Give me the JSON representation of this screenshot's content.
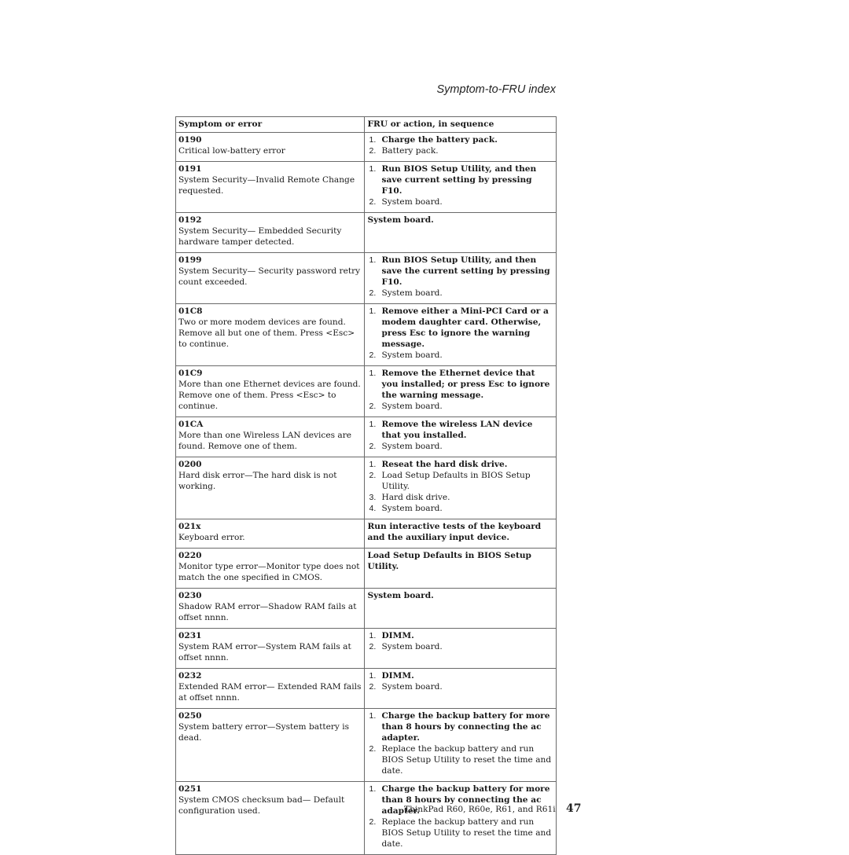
{
  "running_head": "Symptom-to-FRU index",
  "table": {
    "headers": [
      "Symptom or error",
      "FRU or action, in sequence"
    ],
    "rows": [
      {
        "code": "0190",
        "symptom": "Critical low-battery error",
        "actions": [
          {
            "n": "1.",
            "text": "Charge the battery pack.",
            "bold": true
          },
          {
            "n": "2.",
            "text": "Battery pack.",
            "bold": false
          }
        ]
      },
      {
        "code": "0191",
        "symptom": "System Security—Invalid Remote Change requested.",
        "actions": [
          {
            "n": "1.",
            "text": "Run BIOS Setup Utility, and then save current setting by pressing F10.",
            "bold": true
          },
          {
            "n": "2.",
            "text": "System board.",
            "bold": false
          }
        ]
      },
      {
        "code": "0192",
        "symptom": "System Security— Embedded Security hardware tamper detected.",
        "single_action": "System board."
      },
      {
        "code": "0199",
        "symptom": "System Security— Security password retry count exceeded.",
        "actions": [
          {
            "n": "1.",
            "text": "Run BIOS Setup Utility, and then save the current setting by pressing F10.",
            "bold": true
          },
          {
            "n": "2.",
            "text": "System board.",
            "bold": false
          }
        ]
      },
      {
        "code": "01C8",
        "symptom": "Two or more modem devices are found. Remove all but one of them. Press <Esc> to continue.",
        "actions": [
          {
            "n": "1.",
            "text": "Remove either a Mini-PCI Card or a modem daughter card. Otherwise, press Esc to ignore the warning message.",
            "bold": true
          },
          {
            "n": "2.",
            "text": "System board.",
            "bold": false
          }
        ]
      },
      {
        "code": "01C9",
        "symptom": "More than one Ethernet devices are found. Remove one of them. Press <Esc> to continue.",
        "actions": [
          {
            "n": "1.",
            "text": "Remove the Ethernet device that you installed; or press Esc to ignore the warning message.",
            "bold": true
          },
          {
            "n": "2.",
            "text": "System board.",
            "bold": false
          }
        ]
      },
      {
        "code": "01CA",
        "symptom": "More than one Wireless LAN devices are found. Remove one of them.",
        "actions": [
          {
            "n": "1.",
            "text": "Remove the wireless LAN device that you installed.",
            "bold": true
          },
          {
            "n": "2.",
            "text": "System board.",
            "bold": false
          }
        ]
      },
      {
        "code": "0200",
        "symptom": "Hard disk error—The hard disk is not working.",
        "actions": [
          {
            "n": "1.",
            "text": "Reseat the hard disk drive.",
            "bold": true
          },
          {
            "n": "2.",
            "text": "Load Setup Defaults in BIOS Setup Utility.",
            "bold": false
          },
          {
            "n": "3.",
            "text": "Hard disk drive.",
            "bold": false
          },
          {
            "n": "4.",
            "text": "System board.",
            "bold": false
          }
        ]
      },
      {
        "code": "021x",
        "symptom": "Keyboard error.",
        "single_action": "Run interactive tests of the keyboard and the auxiliary input device."
      },
      {
        "code": "0220",
        "symptom": "Monitor type error—Monitor type does not match the one specified in CMOS.",
        "single_action": "Load Setup Defaults in BIOS Setup Utility."
      },
      {
        "code": "0230",
        "symptom": "Shadow RAM error—Shadow RAM fails at offset nnnn.",
        "single_action": "System board."
      },
      {
        "code": "0231",
        "symptom": "System RAM error—System RAM fails at offset nnnn.",
        "actions": [
          {
            "n": "1.",
            "text": "DIMM.",
            "bold": true
          },
          {
            "n": "2.",
            "text": "System board.",
            "bold": false
          }
        ]
      },
      {
        "code": "0232",
        "symptom": "Extended RAM error— Extended RAM fails at offset nnnn.",
        "actions": [
          {
            "n": "1.",
            "text": "DIMM.",
            "bold": true
          },
          {
            "n": "2.",
            "text": "System board.",
            "bold": false
          }
        ]
      },
      {
        "code": "0250",
        "symptom": "System battery error—System battery is dead.",
        "actions": [
          {
            "n": "1.",
            "text": "Charge the backup battery for more than 8 hours by connecting the ac adapter.",
            "bold": true
          },
          {
            "n": "2.",
            "text": "Replace the backup battery and run BIOS Setup Utility to reset the time and date.",
            "bold": false
          }
        ]
      },
      {
        "code": "0251",
        "symptom": "System CMOS checksum bad— Default configuration used.",
        "actions": [
          {
            "n": "1.",
            "text": "Charge the backup battery for more than 8 hours by connecting the ac adapter.",
            "bold": true
          },
          {
            "n": "2.",
            "text": "Replace the backup battery and run BIOS Setup Utility to reset the time and date.",
            "bold": false
          }
        ]
      }
    ]
  },
  "footer": {
    "product": "ThinkPad R60, R60e, R61, and R61i",
    "page_number": "47"
  }
}
